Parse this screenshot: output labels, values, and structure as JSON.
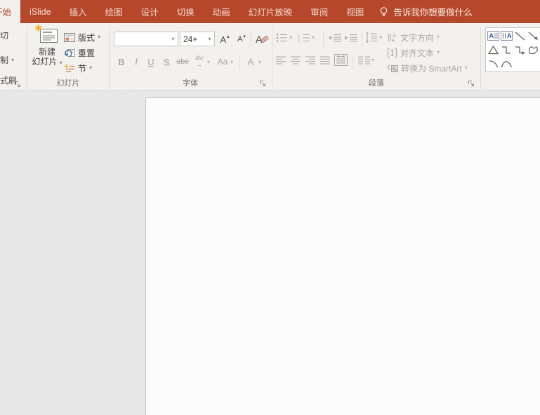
{
  "tabs": {
    "active": "开始",
    "items": [
      "iSlide",
      "插入",
      "绘图",
      "设计",
      "切换",
      "动画",
      "幻灯片放映",
      "审阅",
      "视图"
    ],
    "tell_me": "告诉我你想要做什么"
  },
  "ribbon": {
    "clipboard": {
      "cut_partial": "切",
      "copy_partial": "制",
      "format_painter_partial": "式刷"
    },
    "slides": {
      "label": "幻灯片",
      "new_slide_line1": "新建",
      "new_slide_line2": "幻灯片",
      "layout": "版式",
      "reset": "重置",
      "section": "节"
    },
    "font": {
      "label": "字体",
      "font_name_value": "",
      "font_size_value": "24+",
      "grow_font": "A",
      "shrink_font": "A",
      "clear_format": "A",
      "bold": "B",
      "italic": "I",
      "underline": "U",
      "shadow": "S",
      "strikethrough": "abc",
      "char_spacing": "AV",
      "change_case": "Aa",
      "font_color": "A"
    },
    "paragraph": {
      "label": "段落",
      "text_direction": "文字方向",
      "align_text": "对齐文本",
      "convert_smartart": "转换为 SmartArt"
    }
  },
  "icons": {
    "dropdown": "▾",
    "grow_arrow": "▴",
    "shrink_arrow": "▾",
    "spacing_arrows": "↔",
    "sparkle": "✱"
  },
  "colors": {
    "accent_red": "#b7472a",
    "ribbon_bg": "#f3f1ee",
    "canvas_bg": "#e9e8e8",
    "slide_bg": "#fcfcfc",
    "disabled_gray": "#a9a7a4",
    "sparkle_yellow": "#eeb32d",
    "reset_blue": "#3f74ad",
    "layout_orange": "#d98b52",
    "textbox_blue": "#2b579a"
  }
}
